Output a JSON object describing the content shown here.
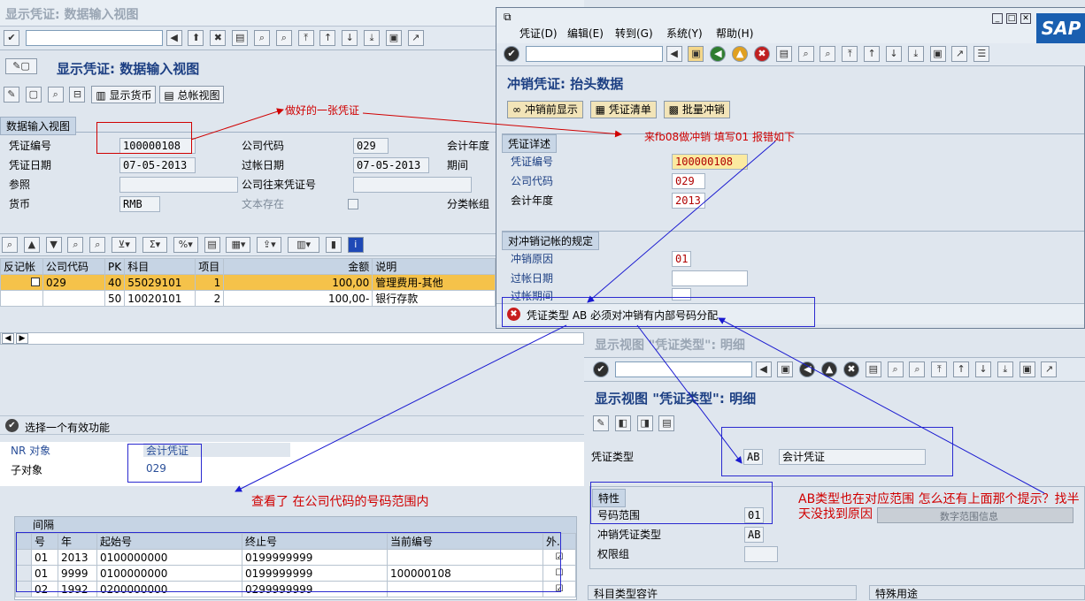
{
  "main": {
    "window_title": "显示凭证: 数据输入视图",
    "page_title": "显示凭证: 数据输入视图",
    "btn_currency": "显示货币",
    "btn_ledger": "总帐视图",
    "tab_label": "数据输入视图",
    "doc_no_label": "凭证编号",
    "doc_no": "100000108",
    "company_label": "公司代码",
    "company": "029",
    "fy_label": "会计年度",
    "doc_date_label": "凭证日期",
    "doc_date": "07-05-2013",
    "post_date_label": "过帐日期",
    "post_date": "07-05-2013",
    "period_label": "期间",
    "ref_label": "参照",
    "ic_label": "公司往来凭证号",
    "currency_label": "货币",
    "currency": "RMB",
    "text_label": "文本存在",
    "ledger_group_label": "分类帐组",
    "table": {
      "headers": [
        "反记帐",
        "公司代码",
        "PK",
        "科目",
        "项目",
        "金额",
        "说明"
      ],
      "rows": [
        [
          "",
          "029",
          "40",
          "55029101",
          "1",
          "100,00",
          "管理费用-其他"
        ],
        [
          "",
          "",
          "50",
          "10020101",
          "2",
          "100,00-",
          "银行存款"
        ]
      ]
    }
  },
  "annotations": {
    "made_voucher": "做好的一张凭证",
    "fb08_note": "来fb08做冲销  填写01  报错如下",
    "checked_note": "查看了  在公司代码的号码范围内",
    "ab_note": "AB类型也在对应范围 怎么还有上面那个提示？找半天没找到原因"
  },
  "reverse": {
    "menu": [
      "凭证(D)",
      "编辑(E)",
      "转到(G)",
      "系统(Y)",
      "帮助(H)"
    ],
    "title": "冲销凭证: 抬头数据",
    "btn_preview": "冲销前显示",
    "btn_list": "凭证清单",
    "btn_mass": "批量冲销",
    "detail_tab": "凭证详述",
    "doc_no_label": "凭证编号",
    "doc_no": "100000108",
    "company_label": "公司代码",
    "company": "029",
    "fy_label": "会计年度",
    "fy": "2013",
    "rules_tab": "对冲销记帐的规定",
    "reason_label": "冲销原因",
    "reason": "01",
    "post_date_label": "过帐日期",
    "period_label": "过帐期间",
    "error": "凭证类型 AB 必须对冲销有内部号码分配",
    "sap_logo": "SAP"
  },
  "nr": {
    "status": "选择一个有效功能",
    "obj_label": "NR 对象",
    "obj": "会计凭证",
    "sub_label": "子对象",
    "sub": "029",
    "interval_title": "间隔",
    "headers": [
      "号",
      "年",
      "起始号",
      "终止号",
      "当前编号",
      "外."
    ],
    "rows": [
      [
        "01",
        "2013",
        "0100000000",
        "0199999999",
        "",
        ""
      ],
      [
        "01",
        "9999",
        "0100000000",
        "0199999999",
        "100000108",
        ""
      ],
      [
        "02",
        "1992",
        "0200000000",
        "0299999999",
        "",
        ""
      ]
    ]
  },
  "doctype": {
    "window_title": "显示视图 \"凭证类型\": 明细",
    "page_title": "显示视图 \"凭证类型\": 明细",
    "type_label": "凭证类型",
    "type": "AB",
    "type_desc": "会计凭证",
    "props_title": "特性",
    "nr_label": "号码范围",
    "nr": "01",
    "rev_label": "冲销凭证类型",
    "rev": "AB",
    "auth_label": "权限组",
    "nr_info": "数字范围信息",
    "acct_tab": "科目类型容许",
    "special_tab": "特殊用途"
  }
}
